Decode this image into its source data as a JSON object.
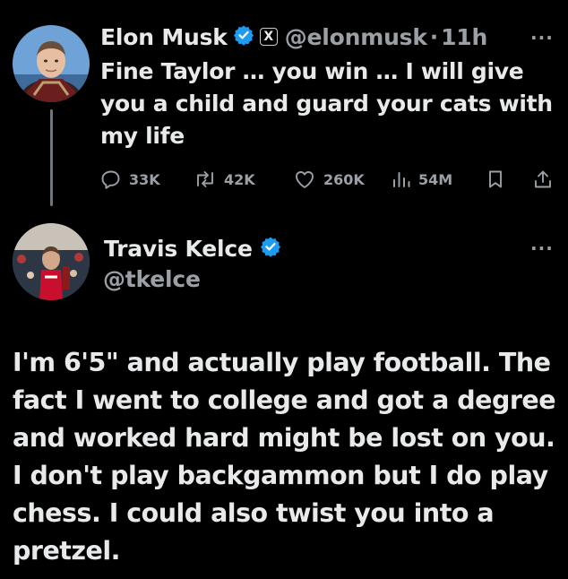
{
  "tweet1": {
    "author_name": "Elon Musk",
    "handle": "@elonmusk",
    "separator": "·",
    "time": "11h",
    "text": "Fine Taylor … you win … I will give you a child and guard your cats with my life",
    "x_badge": "X",
    "more": "···",
    "actions": {
      "replies": "33K",
      "reposts": "42K",
      "likes": "260K",
      "views": "54M"
    }
  },
  "tweet2": {
    "author_name": "Travis Kelce",
    "handle": "@tkelce",
    "more": "···",
    "text": "I'm 6'5\" and actually play football. The fact I went to college and got a degree and worked hard might be lost on you. I don't play backgammon but I do play chess. I could also twist you into a pretzel."
  },
  "colors": {
    "background": "#000000",
    "text_primary": "#e7e9ea",
    "text_secondary": "#9aa0a6",
    "verified_blue": "#1d9bf0"
  },
  "icons": {
    "verified": "verified-badge-icon",
    "x_badge": "x-logo-icon",
    "reply": "reply-icon",
    "repost": "repost-icon",
    "like": "heart-icon",
    "views": "views-icon",
    "bookmark": "bookmark-icon",
    "share": "share-icon",
    "more": "more-icon"
  }
}
